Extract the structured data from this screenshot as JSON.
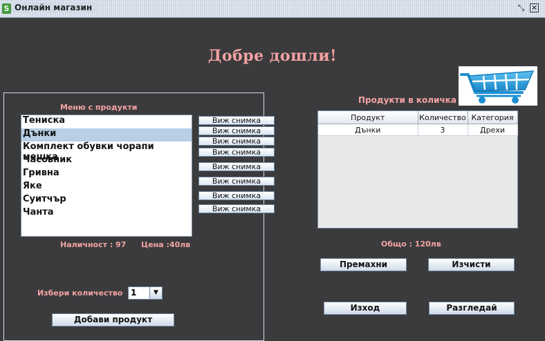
{
  "window": {
    "title": "Онлайн магазин",
    "icon": "shopify-bag-icon"
  },
  "welcome": "Добре дошли!",
  "cart_icon": "shopping-cart-icon",
  "menu": {
    "label": "Меню с продукти",
    "items": [
      {
        "label": "Тениска"
      },
      {
        "label": "Дънки",
        "selected": true
      },
      {
        "label": "Комплект обувки чорапи мешка"
      },
      {
        "label": "Часовник"
      },
      {
        "label": "Гривна"
      },
      {
        "label": "Яке"
      },
      {
        "label": "Суитчър"
      },
      {
        "label": "Чанта"
      }
    ],
    "view_buttons": [
      "Виж снимка",
      "Виж снимка",
      "Виж снимка",
      "Виж снимка",
      "Виж снимка",
      "Виж снимка",
      "Виж снимка",
      "Виж снимка"
    ]
  },
  "stock_label": "Наличност : 97",
  "price_label": "Цена :40лв",
  "quantity": {
    "label": "Избери количество",
    "value": "1"
  },
  "add_button": "Добави продукт",
  "cart": {
    "label": "Продукти в количка",
    "columns": [
      "Продукт",
      "Количество",
      "Категория"
    ],
    "rows": [
      [
        "Дънки",
        "3",
        "Дрехи"
      ]
    ]
  },
  "total_label": "Общо : 120лв",
  "buttons": {
    "remove": "Премахни",
    "clear": "Изчисти",
    "exit": "Изход",
    "browse": "Разгледай"
  }
}
